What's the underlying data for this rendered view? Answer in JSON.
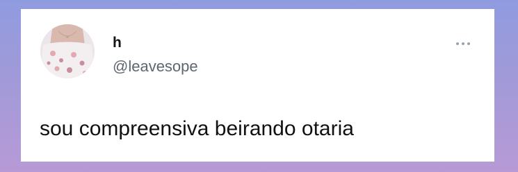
{
  "tweet": {
    "author": {
      "display_name": "h",
      "handle": "@leavesope",
      "avatar_icon": "profile-photo"
    },
    "more_icon": "more-horizontal-icon",
    "text": "sou compreensiva beirando otaria"
  },
  "colors": {
    "background_top": "#8f9be0",
    "background_bottom": "#b79ad6",
    "card": "#ffffff",
    "name": "#141414",
    "handle": "#5e6670",
    "more_dots": "#9aa3ad",
    "text": "#111111"
  }
}
